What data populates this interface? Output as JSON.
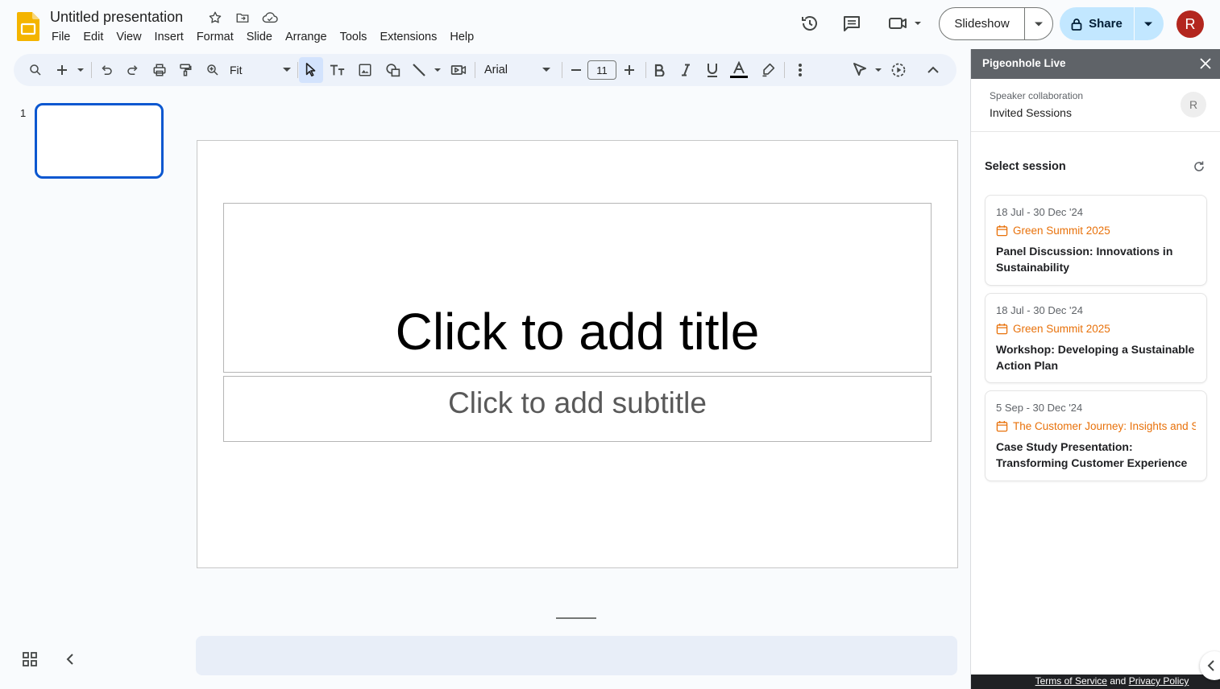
{
  "app": {
    "doc_title": "Untitled presentation",
    "menu": [
      "File",
      "Edit",
      "View",
      "Insert",
      "Format",
      "Slide",
      "Arrange",
      "Tools",
      "Extensions",
      "Help"
    ],
    "slideshow_label": "Slideshow",
    "share_label": "Share",
    "avatar_initial": "R"
  },
  "toolbar": {
    "zoom_value": "Fit",
    "font_name": "Arial",
    "font_size": "11"
  },
  "slides": {
    "current_number": "1"
  },
  "canvas": {
    "title_placeholder": "Click to add title",
    "subtitle_placeholder": "Click to add subtitle"
  },
  "side_panel": {
    "title": "Pigeonhole Live",
    "collab_label": "Speaker collaboration",
    "collab_value": "Invited Sessions",
    "collab_avatar": "R",
    "select_session": "Select session",
    "sessions": [
      {
        "date": "18 Jul - 30 Dec '24",
        "event": "Green Summit 2025",
        "name": "Panel Discussion: Innovations in Sustainability"
      },
      {
        "date": "18 Jul - 30 Dec '24",
        "event": "Green Summit 2025",
        "name": "Workshop: Developing a Sustainable Action Plan"
      },
      {
        "date": "5 Sep - 30 Dec '24",
        "event": "The Customer Journey: Insights and S",
        "name": "Case Study Presentation: Transforming Customer Experience"
      }
    ],
    "footer": {
      "terms": "Terms of Service",
      "and": "and",
      "privacy": "Privacy Policy"
    }
  },
  "colors": {
    "accent_blue": "#0b57d0",
    "share_bg": "#c2e7ff",
    "event_orange": "#e8710a",
    "panel_header": "#5f6368"
  }
}
